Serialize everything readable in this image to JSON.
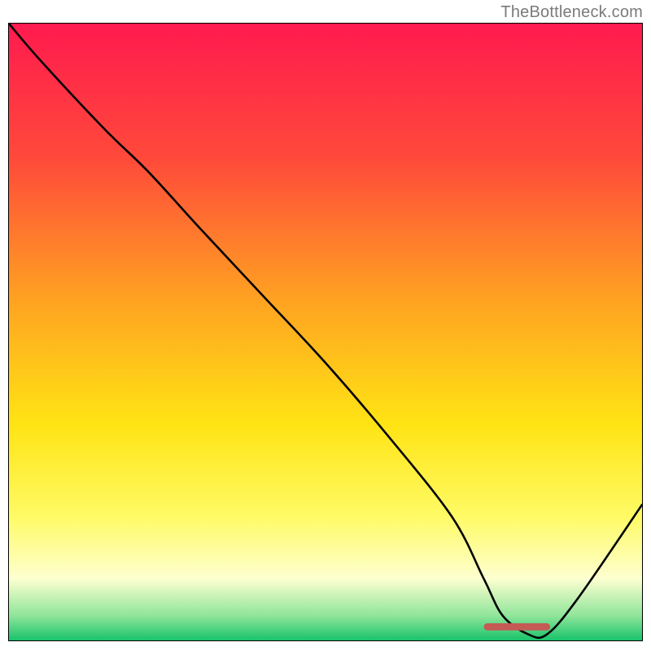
{
  "attribution": "TheBottleneck.com",
  "chart_data": {
    "type": "line",
    "title": "",
    "xlabel": "",
    "ylabel": "",
    "xlim": [
      0,
      100
    ],
    "ylim": [
      0,
      100
    ],
    "gradient_stops": [
      {
        "offset": 0,
        "color": "#ff1a4f"
      },
      {
        "offset": 22,
        "color": "#ff4a3a"
      },
      {
        "offset": 45,
        "color": "#ffa321"
      },
      {
        "offset": 65,
        "color": "#ffe414"
      },
      {
        "offset": 80,
        "color": "#fffb66"
      },
      {
        "offset": 90,
        "color": "#fdffd0"
      },
      {
        "offset": 96,
        "color": "#8fe59a"
      },
      {
        "offset": 100,
        "color": "#18c36b"
      }
    ],
    "curve": {
      "x": [
        0,
        5,
        15,
        22,
        30,
        40,
        50,
        60,
        70,
        75,
        78,
        82,
        85,
        90,
        100
      ],
      "y": [
        100,
        94,
        83,
        76,
        67,
        56,
        45,
        33,
        20,
        10,
        4,
        1,
        1,
        7,
        22
      ]
    },
    "marker": {
      "x_start": 75,
      "x_end": 85.5,
      "y": 2.2,
      "color": "#c45a54"
    }
  }
}
